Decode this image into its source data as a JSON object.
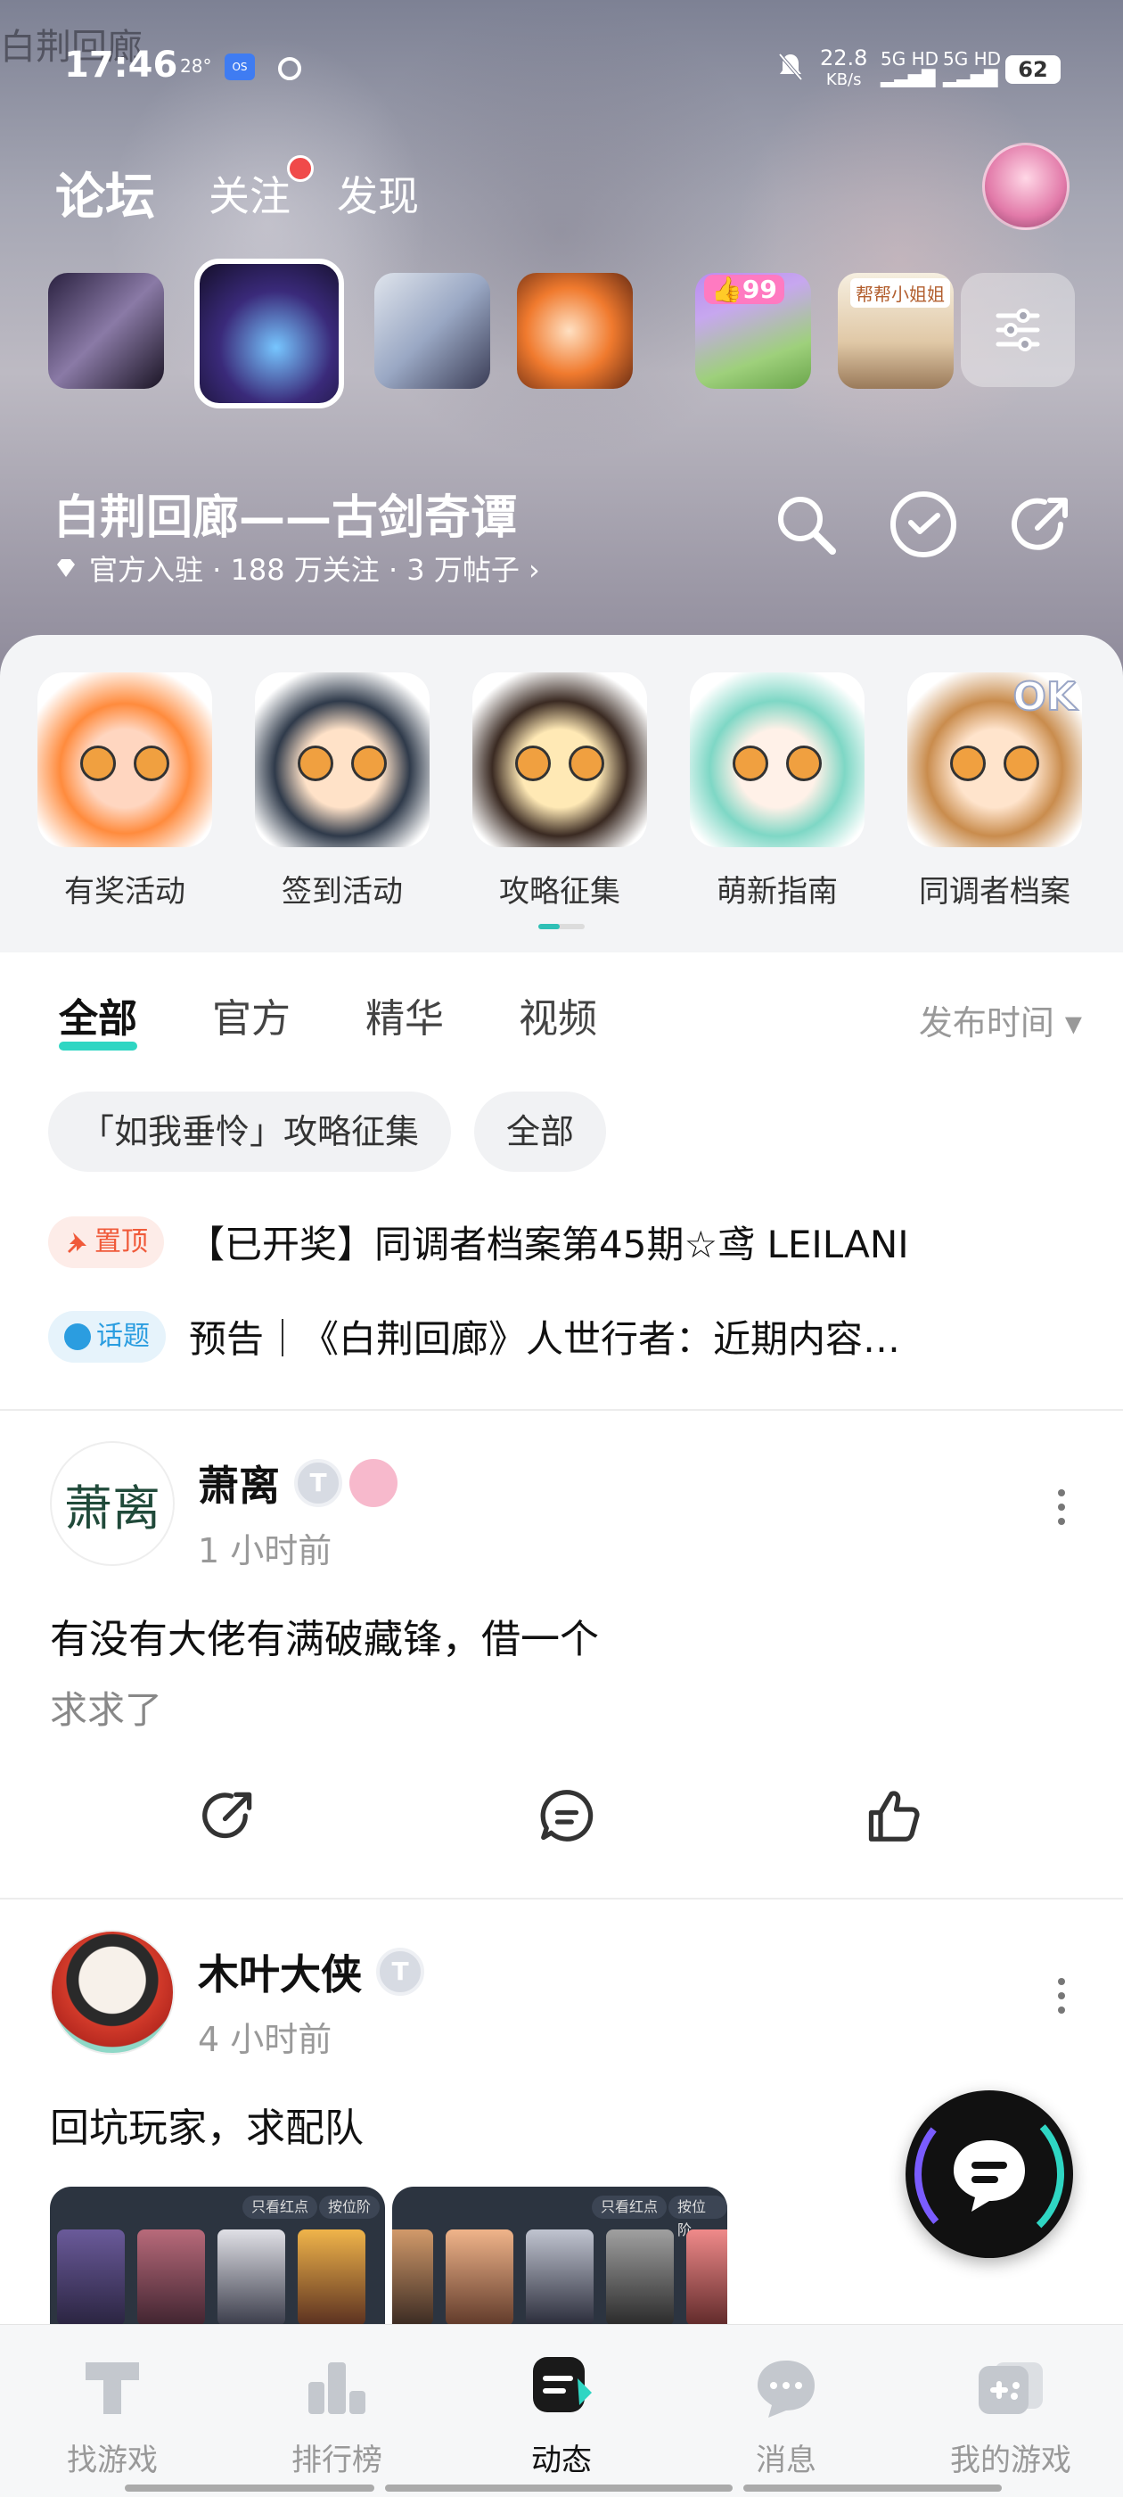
{
  "status_bar": {
    "watermark": "白荆回廊",
    "time": "17:46",
    "temperature": "28°",
    "net_speed": "22.8",
    "net_unit": "KB/s",
    "signal1": "5G HD",
    "signal2": "5G HD",
    "battery": "62"
  },
  "top_nav": {
    "forum": "论坛",
    "follow": "关注",
    "discover": "发现"
  },
  "games": {
    "badge_99": "👍99",
    "g6_label": "帮帮小姐姐"
  },
  "forum": {
    "title": "白荆回廊——古剑奇谭",
    "meta": "官方入驻 · 188 万关注 · 3 万帖子 ›"
  },
  "activities": [
    {
      "label": "有奖活动"
    },
    {
      "label": "签到活动"
    },
    {
      "label": "攻略征集"
    },
    {
      "label": "萌新指南"
    },
    {
      "label": "同调者档案",
      "badge": "OK"
    }
  ],
  "filter_tabs": [
    "全部",
    "官方",
    "精华",
    "视频"
  ],
  "sort_label": "发布时间 ▾",
  "chips": [
    "「如我垂怜」攻略征集",
    "全部"
  ],
  "pinned": [
    {
      "tag": "置顶",
      "text": "【已开奖】同调者档案第45期☆鸢 LEILANI"
    },
    {
      "tag": "话题",
      "text": "预告｜《白荆回廊》人世行者：近期内容…"
    }
  ],
  "posts": [
    {
      "avatar_text": "萧离",
      "name": "萧离",
      "level": "T",
      "time": "1 小时前",
      "title": "有没有大佬有满破藏锋，借一个",
      "body": "求求了"
    },
    {
      "name": "木叶大侠",
      "level": "T",
      "time": "4 小时前",
      "title": "回坑玩家，求配队",
      "thumb_pill1": "只看红点",
      "thumb_pill2": "按位阶"
    }
  ],
  "bottom_nav": [
    "找游戏",
    "排行榜",
    "动态",
    "消息",
    "我的游戏"
  ],
  "colors": {
    "accent": "#2fd6c3",
    "pin_red": "#f05a3a",
    "topic_blue": "#2b9de0",
    "badge_red": "#f04a4a"
  }
}
